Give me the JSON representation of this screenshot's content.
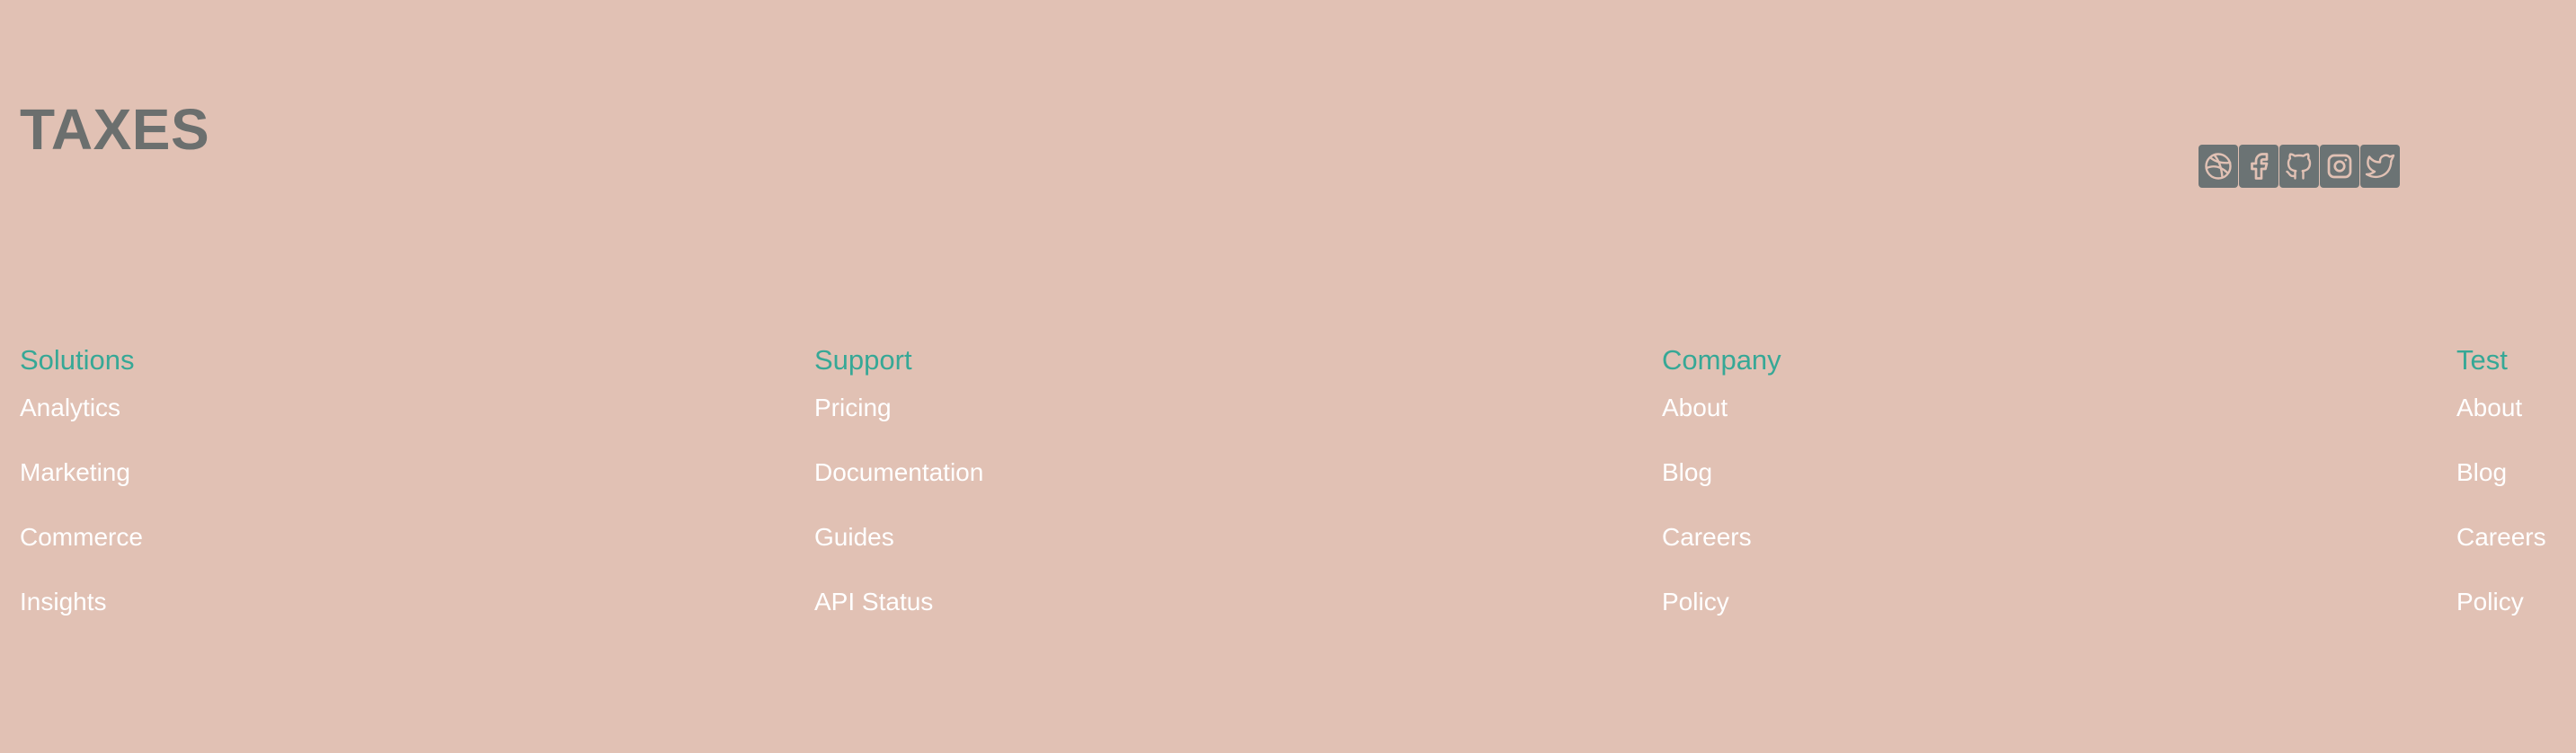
{
  "brand": {
    "name": "TAXES"
  },
  "social": [
    {
      "icon": "dribbble-icon"
    },
    {
      "icon": "facebook-icon"
    },
    {
      "icon": "github-icon"
    },
    {
      "icon": "instagram-icon"
    },
    {
      "icon": "twitter-icon"
    }
  ],
  "columns": [
    {
      "title": "Solutions",
      "links": [
        "Analytics",
        "Marketing",
        "Commerce",
        "Insights"
      ]
    },
    {
      "title": "Support",
      "links": [
        "Pricing",
        "Documentation",
        "Guides",
        "API Status"
      ]
    },
    {
      "title": "Company",
      "links": [
        "About",
        "Blog",
        "Careers",
        "Policy"
      ]
    },
    {
      "title": "Test",
      "links": [
        "About",
        "Blog",
        "Careers",
        "Policy"
      ]
    }
  ],
  "colors": {
    "background": "#e1c1b4",
    "brand_text": "#6b6f6e",
    "heading": "#36a896",
    "link": "#ffffff",
    "icon_bg": "#6b7374",
    "icon_fg": "#e1c1b4"
  }
}
